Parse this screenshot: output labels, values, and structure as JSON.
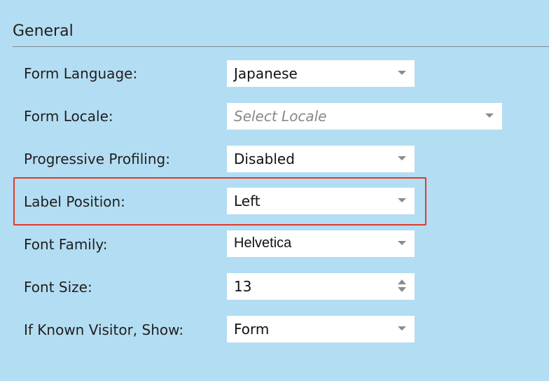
{
  "section": {
    "title": "General"
  },
  "fields": [
    {
      "label": "Form Language:",
      "value": "Japanese",
      "control": "dropdown"
    },
    {
      "label": "Form Locale:",
      "placeholder": "Select Locale",
      "control": "dropdown"
    },
    {
      "label": "Progressive Profiling:",
      "value": "Disabled",
      "control": "dropdown"
    },
    {
      "label": "Label Position:",
      "value": "Left",
      "control": "dropdown",
      "highlighted": true
    },
    {
      "label": "Font Family:",
      "value": "Helvetica",
      "control": "dropdown"
    },
    {
      "label": "Font Size:",
      "value": "13",
      "control": "number"
    },
    {
      "label": "If Known Visitor, Show:",
      "value": "Form",
      "control": "dropdown"
    }
  ],
  "colors": {
    "background": "#b3ddf2",
    "field": "#ffffff",
    "highlight_border": "#e03a2a"
  },
  "icons": {
    "dropdown": "chevron-down-icon",
    "number": "stepper-arrows-icon"
  }
}
